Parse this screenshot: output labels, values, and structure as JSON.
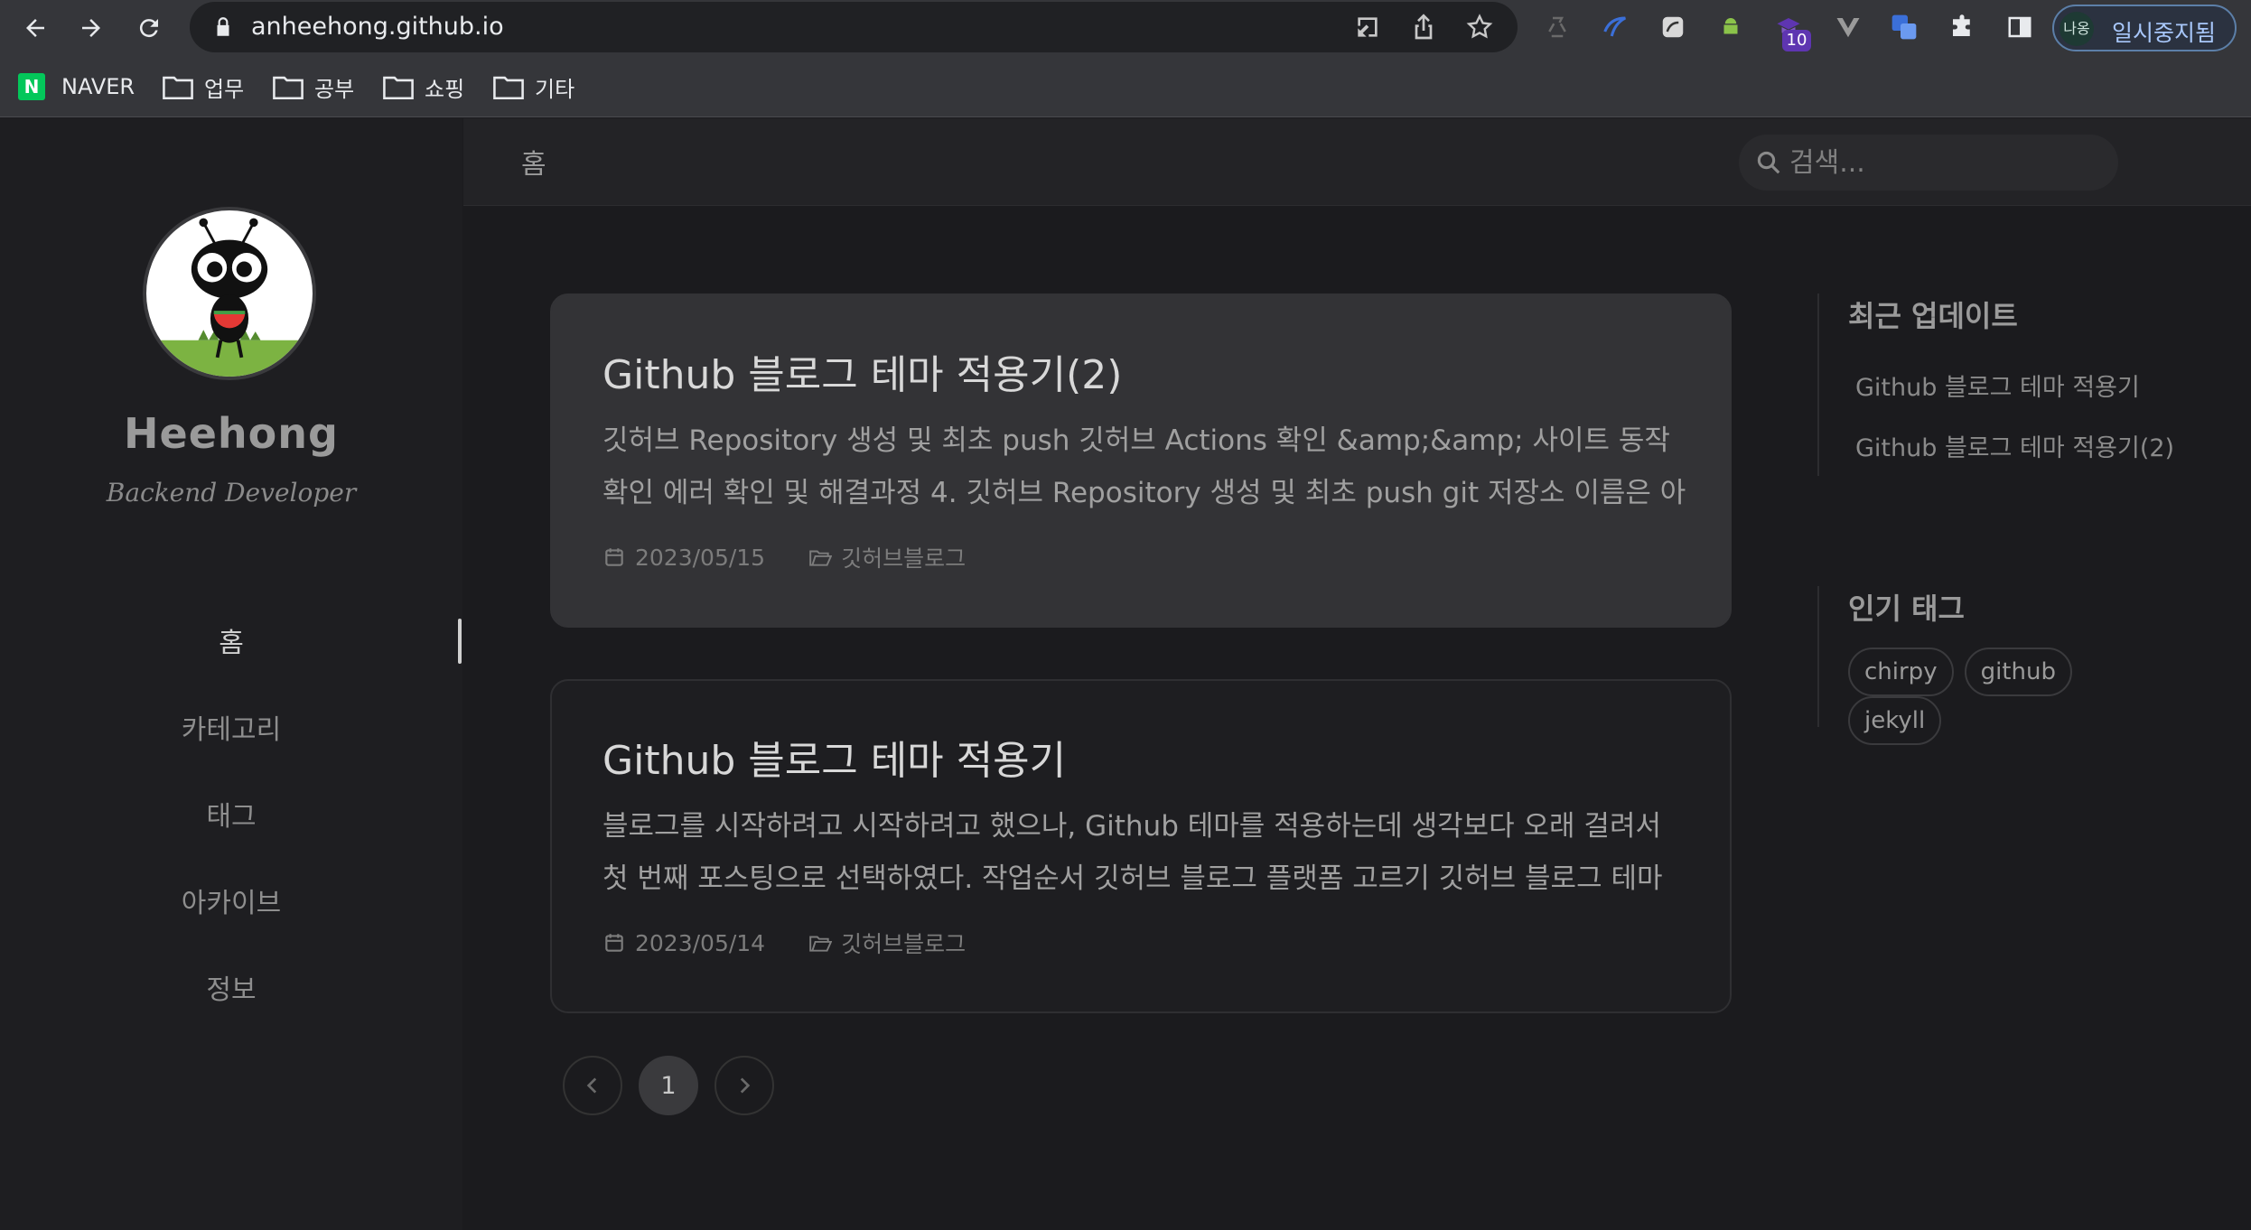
{
  "browser": {
    "url": "anheehong.github.io",
    "extension_badge": "10",
    "profile_avatar": "나옹",
    "profile_status": "일시중지됨",
    "icons": [
      "back-icon",
      "forward-icon",
      "reload-icon",
      "lock-icon",
      "install-icon",
      "share-icon",
      "star-icon",
      "puzzle-icon",
      "side-panel-icon"
    ]
  },
  "bookmarks": [
    {
      "label": "NAVER"
    },
    {
      "label": "업무"
    },
    {
      "label": "공부"
    },
    {
      "label": "쇼핑"
    },
    {
      "label": "기타"
    }
  ],
  "sidebar": {
    "site_title": "Heehong",
    "site_subtitle": "Backend Developer",
    "nav": [
      {
        "label": "홈",
        "active": true
      },
      {
        "label": "카테고리"
      },
      {
        "label": "태그"
      },
      {
        "label": "아카이브"
      },
      {
        "label": "정보"
      }
    ]
  },
  "topbar": {
    "breadcrumb": "홈",
    "search_placeholder": "검색..."
  },
  "posts": [
    {
      "title": "Github 블로그 테마 적용기(2)",
      "excerpt": "깃허브 Repository 생성 및 최초 push 깃허브 Actions 확인 &amp;&amp; 사이트 동작 확인 에러 확인 및 해결과정 4. 깃허브 Repository 생성 및 최초 push git 저장소 이름은 아이디와 동…",
      "date": "2023/05/15",
      "category": "깃허브블로그"
    },
    {
      "title": "Github 블로그 테마 적용기",
      "excerpt": "블로그를 시작하려고 시작하려고 했으나, Github 테마를 적용하는데 생각보다 오래 걸려서 첫 번째 포스팅으로 선택하였다. 작업순서 깃허브 블로그 플랫폼 고르기 깃허브 블로그 테마 고…",
      "date": "2023/05/14",
      "category": "깃허브블로그"
    }
  ],
  "pagination": {
    "current": "1"
  },
  "recent_updates": {
    "heading": "최근 업데이트",
    "items": [
      "Github 블로그 테마 적용기",
      "Github 블로그 테마 적용기(2)"
    ]
  },
  "popular_tags": {
    "heading": "인기 태그",
    "items": [
      "chirpy",
      "github",
      "jekyll"
    ]
  },
  "colors": {
    "accent": "#d0d0d0",
    "background": "#1b1b1e",
    "card_hover": "#333336"
  }
}
